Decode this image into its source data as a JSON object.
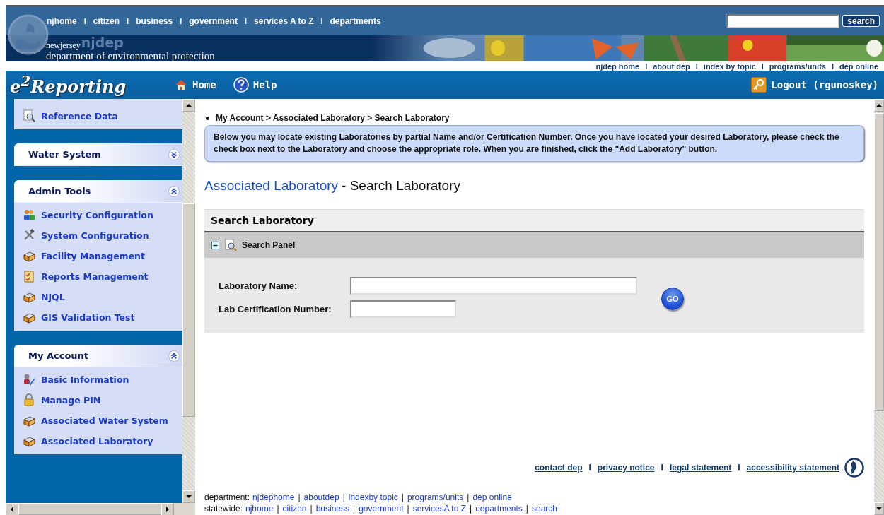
{
  "top_nav": {
    "links": [
      {
        "kind": "link",
        "text": "njhome"
      },
      {
        "kind": "separator",
        "text": "I"
      },
      {
        "kind": "link",
        "text": "citizen"
      },
      {
        "kind": "separator",
        "text": "I"
      },
      {
        "kind": "link",
        "text": "business"
      },
      {
        "kind": "separator",
        "text": "I"
      },
      {
        "kind": "link",
        "text": "government"
      },
      {
        "kind": "separator",
        "text": "I"
      },
      {
        "kind": "link",
        "text": "services A to Z"
      },
      {
        "kind": "separator",
        "text": "I"
      },
      {
        "kind": "link",
        "text": "departments"
      }
    ],
    "search_button": "search"
  },
  "banner": {
    "small": "newjersey",
    "mark": "njdep",
    "name": "department of environmental protection",
    "kind": "picture"
  },
  "dep_links": [
    {
      "kind": "link",
      "text": "njdep home"
    },
    {
      "kind": "separator",
      "text": "I"
    },
    {
      "kind": "link",
      "text": "about dep"
    },
    {
      "kind": "separator",
      "text": "I"
    },
    {
      "kind": "link",
      "text": "index by topic"
    },
    {
      "kind": "separator",
      "text": "I"
    },
    {
      "kind": "link",
      "text": "programs/units"
    },
    {
      "kind": "separator",
      "text": "I"
    },
    {
      "kind": "link",
      "text": "dep online"
    }
  ],
  "app_bar": {
    "logo": "e$^{2}$Reporting",
    "home": "Home",
    "help": "Help",
    "logout": "Logout (rgunoskey)"
  },
  "sidebar": {
    "sections": [
      {
        "items": [
          "Reference Data"
        ]
      },
      {
        "title": "Water System",
        "expanded": false
      },
      {
        "title": "Admin Tools",
        "expanded": true,
        "items": [
          "Security Configuration",
          "System Configuration",
          "Facility Management",
          "Reports Management",
          "NJQL",
          "GIS Validation Test"
        ]
      },
      {
        "title": "My Account",
        "expanded": true,
        "items": [
          "Basic Information",
          "Manage PIN",
          "Associated Water System",
          "Associated Laboratory"
        ]
      }
    ]
  },
  "main": {
    "breadcrumb": "My Account > Associated Laboratory > Search Laboratory",
    "info": "Below you may locate existing Laboratories by partial Name and/or Certification Number. Once you have located your desired Laboratory, please check the check box next to the Laboratory and choose the appropriate role. When you are finished, click the \"Add Laboratory\" button.",
    "heading_link": "Associated Laboratory",
    "heading_rest": "- Search Laboratory",
    "panel_title": "Search Laboratory",
    "search_panel": {
      "title": "Search Panel",
      "expanded": true
    },
    "fields": [
      {
        "label": "Laboratory Name:",
        "kind": "wide"
      },
      {
        "label": "Lab Certification Number:",
        "kind": "narrow"
      }
    ],
    "go_button": "GO"
  },
  "footer": {
    "links": [
      {
        "kind": "link",
        "text": "contact dep"
      },
      {
        "kind": "separator",
        "text": "I"
      },
      {
        "kind": "link",
        "text": "privacy notice"
      },
      {
        "kind": "separator",
        "text": "I"
      },
      {
        "kind": "link",
        "text": "legal statement"
      },
      {
        "kind": "separator",
        "text": "I"
      },
      {
        "kind": "link",
        "text": "accessibility statement"
      }
    ],
    "lines": [
      {
        "label": "department:",
        "items": [
          {
            "kind": "link",
            "text": "njdephome"
          },
          {
            "kind": "separator",
            "text": "|"
          },
          {
            "kind": "link",
            "text": "aboutdep"
          },
          {
            "kind": "separator",
            "text": "|"
          },
          {
            "kind": "link",
            "text": "indexby topic"
          },
          {
            "kind": "separator",
            "text": "|"
          },
          {
            "kind": "link",
            "text": "programs/units"
          },
          {
            "kind": "separator",
            "text": "|"
          },
          {
            "kind": "link",
            "text": "dep online"
          }
        ]
      },
      {
        "label": "statewide:",
        "items": [
          {
            "kind": "link",
            "text": "njhome"
          },
          {
            "kind": "separator",
            "text": "|"
          },
          {
            "kind": "link",
            "text": "citizen"
          },
          {
            "kind": "separator",
            "text": "|"
          },
          {
            "kind": "link",
            "text": "business"
          },
          {
            "kind": "separator",
            "text": "|"
          },
          {
            "kind": "link",
            "text": "government"
          },
          {
            "kind": "separator",
            "text": "|"
          },
          {
            "kind": "link",
            "text": "servicesA to Z"
          },
          {
            "kind": "separator",
            "text": "|"
          },
          {
            "kind": "link",
            "text": "departments"
          },
          {
            "kind": "separator",
            "text": "|"
          },
          {
            "kind": "link",
            "text": "search"
          }
        ]
      }
    ]
  }
}
